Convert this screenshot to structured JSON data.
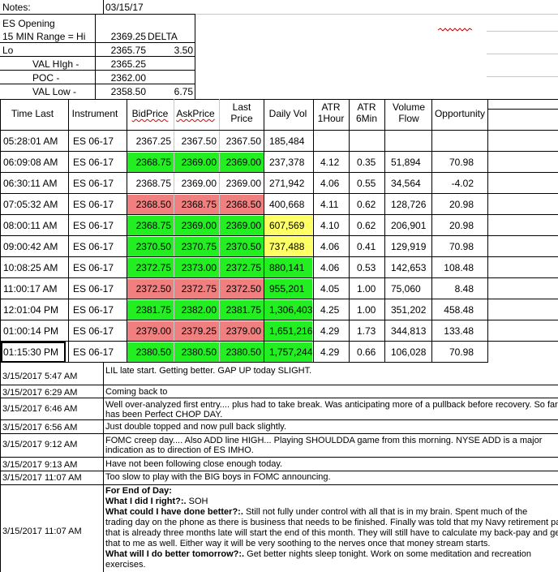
{
  "notes": {
    "label": "Notes:",
    "date": "03/15/17"
  },
  "opening": {
    "title": "ES Opening",
    "range_label": "15 MIN Range = Hi",
    "hi": "2369.25",
    "delta_label": "DELTA",
    "lo_label": "Lo",
    "lo": "2365.75",
    "range_delta": "3.50",
    "val_high_label": "VAL HIgh  -",
    "val_high": "2365.25",
    "poc_label": "POC  -",
    "poc": "2362.00",
    "val_low_label": "VAL Low  -",
    "val_low": "2358.50",
    "value_area_delta": "6.75"
  },
  "table": {
    "headers": {
      "time": "Time Last",
      "instrument": "Instrument",
      "bid": "BidPrice",
      "ask": "AskPrice",
      "last": "Last Price",
      "vol": "Daily Vol",
      "atr1": "ATR 1Hour",
      "atr6": "ATR 6Min",
      "flow": "Volume Flow",
      "opp": "Opportunity"
    },
    "rows": [
      {
        "time": "05:28:01 AM",
        "inst": "ES 06-17",
        "bid": "2367.25",
        "ask": "2367.50",
        "last": "2367.50",
        "vol": "185,484",
        "atr1": "",
        "atr6": "",
        "flow": "",
        "opp": ""
      },
      {
        "time": "06:09:08 AM",
        "inst": "ES 06-17",
        "bid": "2368.75",
        "ask": "2369.00",
        "last": "2369.00",
        "vol": "237,378",
        "atr1": "4.12",
        "atr6": "0.35",
        "flow": "51,894",
        "opp": "70.98"
      },
      {
        "time": "06:30:11 AM",
        "inst": "ES 06-17",
        "bid": "2368.75",
        "ask": "2369.00",
        "last": "2369.00",
        "vol": "271,942",
        "atr1": "4.06",
        "atr6": "0.55",
        "flow": "34,564",
        "opp": "-4.02"
      },
      {
        "time": "07:05:32 AM",
        "inst": "ES 06-17",
        "bid": "2368.50",
        "ask": "2368.75",
        "last": "2368.50",
        "vol": "400,668",
        "atr1": "4.11",
        "atr6": "0.62",
        "flow": "128,726",
        "opp": "20.98"
      },
      {
        "time": "08:00:11 AM",
        "inst": "ES 06-17",
        "bid": "2368.75",
        "ask": "2369.00",
        "last": "2369.00",
        "vol": "607,569",
        "atr1": "4.10",
        "atr6": "0.62",
        "flow": "206,901",
        "opp": "20.98"
      },
      {
        "time": "09:00:42 AM",
        "inst": "ES 06-17",
        "bid": "2370.50",
        "ask": "2370.75",
        "last": "2370.50",
        "vol": "737,488",
        "atr1": "4.06",
        "atr6": "0.41",
        "flow": "129,919",
        "opp": "70.98"
      },
      {
        "time": "10:08:25 AM",
        "inst": "ES 06-17",
        "bid": "2372.75",
        "ask": "2373.00",
        "last": "2372.75",
        "vol": "880,141",
        "atr1": "4.06",
        "atr6": "0.53",
        "flow": "142,653",
        "opp": "108.48"
      },
      {
        "time": "11:00:17 AM",
        "inst": "ES 06-17",
        "bid": "2372.50",
        "ask": "2372.75",
        "last": "2372.50",
        "vol": "955,201",
        "atr1": "4.05",
        "atr6": "1.00",
        "flow": "75,060",
        "opp": "8.48"
      },
      {
        "time": "12:01:04 PM",
        "inst": "ES 06-17",
        "bid": "2381.75",
        "ask": "2382.00",
        "last": "2381.75",
        "vol": "1,306,403",
        "atr1": "4.25",
        "atr6": "1.00",
        "flow": "351,202",
        "opp": "458.48"
      },
      {
        "time": "01:00:14 PM",
        "inst": "ES 06-17",
        "bid": "2379.00",
        "ask": "2379.25",
        "last": "2379.00",
        "vol": "1,651,216",
        "atr1": "4.29",
        "atr6": "1.73",
        "flow": "344,813",
        "opp": "133.48"
      },
      {
        "time": "01:15:30 PM",
        "inst": "ES 06-17",
        "bid": "2380.50",
        "ask": "2380.50",
        "last": "2380.50",
        "vol": "1,757,244",
        "atr1": "4.29",
        "atr6": "0.66",
        "flow": "106,028",
        "opp": "70.98"
      }
    ]
  },
  "row_colors": {
    "price": [
      "none",
      "green",
      "none",
      "red",
      "green",
      "green",
      "green",
      "red",
      "green",
      "red",
      "green"
    ],
    "vol": [
      "none",
      "none",
      "none",
      "none",
      "yellow",
      "yellow",
      "green",
      "green",
      "green",
      "green",
      "green"
    ]
  },
  "colors": {
    "green": "#22ee22",
    "red": "#f08080",
    "yellow": "#ffff66"
  },
  "log": [
    {
      "stamp": "3/15/2017 5:47 AM",
      "lines": [
        "LIL late start.  Getting better.  GAP UP today SLIGHT."
      ]
    },
    {
      "stamp": "3/15/2017 6:29 AM",
      "lines": [
        "Coming back to"
      ]
    },
    {
      "stamp": "3/15/2017 6:46 AM",
      "lines": [
        "Well over-analyzed first entry.... plus had to take break.  Was anticipating more of a pullback before recovery.  So far",
        "has been Perfect CHOP DAY."
      ]
    },
    {
      "stamp": "3/15/2017 6:56 AM",
      "lines": [
        "Just double topped and now pull back slightly."
      ]
    },
    {
      "stamp": "3/15/2017 9:12 AM",
      "lines": [
        "FOMC creep day.... Also ADD line HIGH... Playing SHOULDDA game from this morning.  NYSE ADD is a major",
        "indication as to direction of ES IMHO."
      ]
    },
    {
      "stamp": "3/15/2017 9:13 AM",
      "lines": [
        "Have not been following close enough today."
      ]
    },
    {
      "stamp": "3/15/2017 11:07 AM",
      "lines": [
        "Too slow to play with the BIG boys in FOMC announcing."
      ]
    }
  ],
  "end_of_day": {
    "stamp": "3/15/2017 11:07 AM",
    "title": "For End of Day:",
    "q1": "What I did I right?:.",
    "a1": " SOH",
    "q2": "What could I have done better?:.",
    "a2_first": " Still not fully under control with all that is in my brain.  Spent much of the",
    "a2_rest": [
      "trading day on the phone as there is business that needs to be finished.  Finally was told that my Navy retirement pay",
      "that is already three months late will start the end of this month.  They will still have to calculate my back-pay and get",
      "that to me as well.  Either way it will be very soothing to the nerves once that money stream starts."
    ],
    "q3": "What will I do better tomorrow?:.",
    "a3_first": "  Get better nights sleep tonight.  Work on some meditation and recreation",
    "a3_rest": [
      "exercises."
    ]
  }
}
